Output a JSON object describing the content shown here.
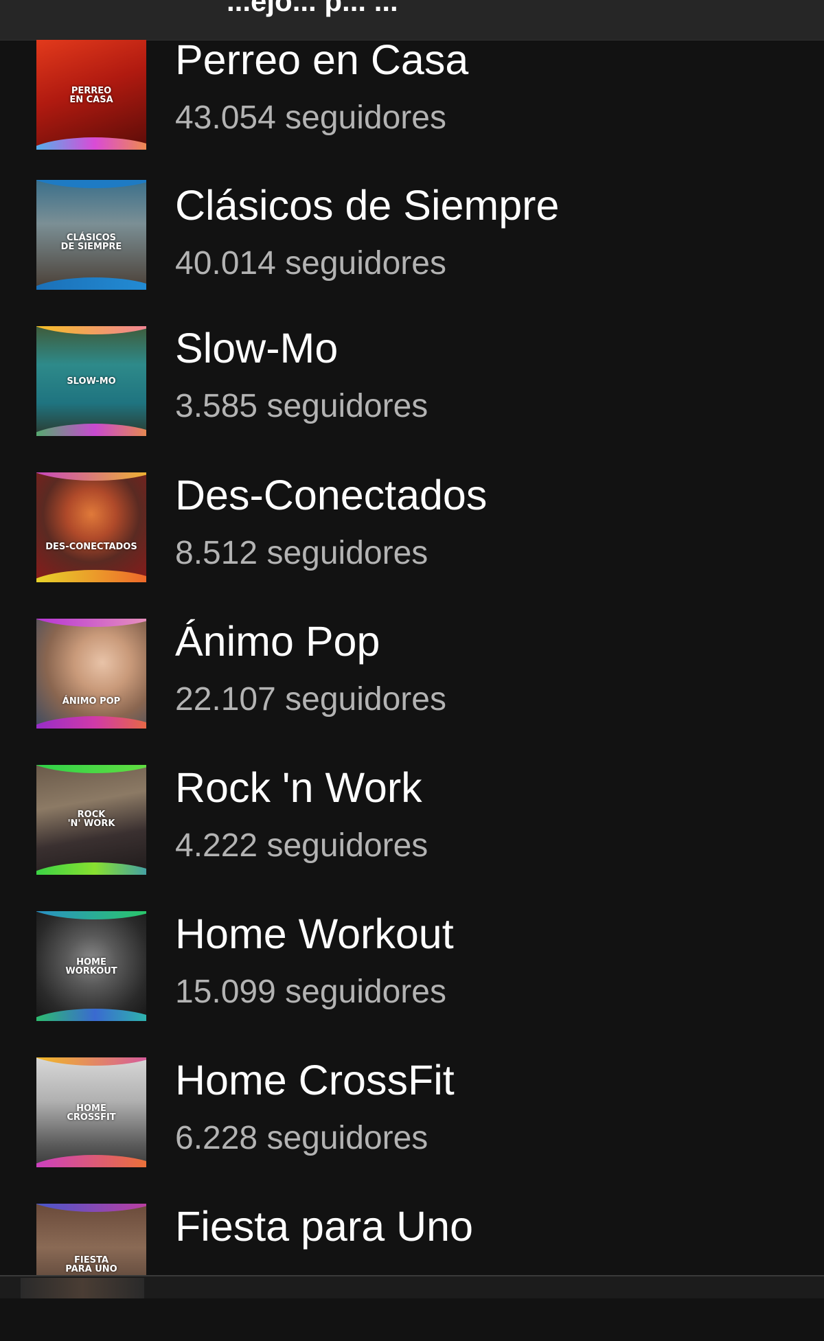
{
  "header": {
    "title_fragment": "...ejo... p... ..."
  },
  "playlists": [
    {
      "name": "Perreo en Casa",
      "followers": "43.054 seguidores",
      "cover_text": "PERREO\nEN CASA"
    },
    {
      "name": "Clásicos de Siempre",
      "followers": "40.014 seguidores",
      "cover_text": "CLÁSICOS\nDE SIEMPRE"
    },
    {
      "name": "Slow-Mo",
      "followers": "3.585 seguidores",
      "cover_text": "SLOW-MO"
    },
    {
      "name": "Des-Conectados",
      "followers": "8.512 seguidores",
      "cover_text": "DES-CONECTADOS"
    },
    {
      "name": "Ánimo Pop",
      "followers": "22.107 seguidores",
      "cover_text": "ÁNIMO POP"
    },
    {
      "name": "Rock 'n Work",
      "followers": "4.222 seguidores",
      "cover_text": "ROCK\n'N' WORK"
    },
    {
      "name": "Home Workout",
      "followers": "15.099 seguidores",
      "cover_text": "HOME\nWORKOUT"
    },
    {
      "name": "Home CrossFit",
      "followers": "6.228 seguidores",
      "cover_text": "HOME\nCROSSFIT"
    },
    {
      "name": "Fiesta para Uno",
      "followers": "",
      "cover_text": "FIESTA\nPARA UNO"
    }
  ]
}
